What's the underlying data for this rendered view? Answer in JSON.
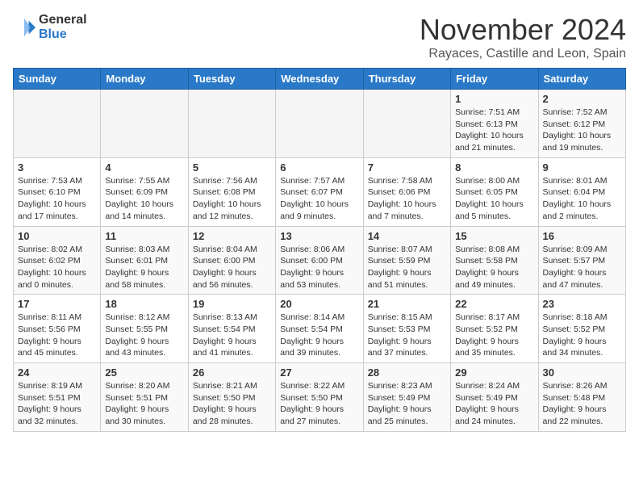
{
  "header": {
    "logo_general": "General",
    "logo_blue": "Blue",
    "month_title": "November 2024",
    "location": "Rayaces, Castille and Leon, Spain"
  },
  "days_of_week": [
    "Sunday",
    "Monday",
    "Tuesday",
    "Wednesday",
    "Thursday",
    "Friday",
    "Saturday"
  ],
  "weeks": [
    [
      {
        "day": "",
        "sunrise": "",
        "sunset": "",
        "daylight": ""
      },
      {
        "day": "",
        "sunrise": "",
        "sunset": "",
        "daylight": ""
      },
      {
        "day": "",
        "sunrise": "",
        "sunset": "",
        "daylight": ""
      },
      {
        "day": "",
        "sunrise": "",
        "sunset": "",
        "daylight": ""
      },
      {
        "day": "",
        "sunrise": "",
        "sunset": "",
        "daylight": ""
      },
      {
        "day": "1",
        "sunrise": "Sunrise: 7:51 AM",
        "sunset": "Sunset: 6:13 PM",
        "daylight": "Daylight: 10 hours and 21 minutes."
      },
      {
        "day": "2",
        "sunrise": "Sunrise: 7:52 AM",
        "sunset": "Sunset: 6:12 PM",
        "daylight": "Daylight: 10 hours and 19 minutes."
      }
    ],
    [
      {
        "day": "3",
        "sunrise": "Sunrise: 7:53 AM",
        "sunset": "Sunset: 6:10 PM",
        "daylight": "Daylight: 10 hours and 17 minutes."
      },
      {
        "day": "4",
        "sunrise": "Sunrise: 7:55 AM",
        "sunset": "Sunset: 6:09 PM",
        "daylight": "Daylight: 10 hours and 14 minutes."
      },
      {
        "day": "5",
        "sunrise": "Sunrise: 7:56 AM",
        "sunset": "Sunset: 6:08 PM",
        "daylight": "Daylight: 10 hours and 12 minutes."
      },
      {
        "day": "6",
        "sunrise": "Sunrise: 7:57 AM",
        "sunset": "Sunset: 6:07 PM",
        "daylight": "Daylight: 10 hours and 9 minutes."
      },
      {
        "day": "7",
        "sunrise": "Sunrise: 7:58 AM",
        "sunset": "Sunset: 6:06 PM",
        "daylight": "Daylight: 10 hours and 7 minutes."
      },
      {
        "day": "8",
        "sunrise": "Sunrise: 8:00 AM",
        "sunset": "Sunset: 6:05 PM",
        "daylight": "Daylight: 10 hours and 5 minutes."
      },
      {
        "day": "9",
        "sunrise": "Sunrise: 8:01 AM",
        "sunset": "Sunset: 6:04 PM",
        "daylight": "Daylight: 10 hours and 2 minutes."
      }
    ],
    [
      {
        "day": "10",
        "sunrise": "Sunrise: 8:02 AM",
        "sunset": "Sunset: 6:02 PM",
        "daylight": "Daylight: 10 hours and 0 minutes."
      },
      {
        "day": "11",
        "sunrise": "Sunrise: 8:03 AM",
        "sunset": "Sunset: 6:01 PM",
        "daylight": "Daylight: 9 hours and 58 minutes."
      },
      {
        "day": "12",
        "sunrise": "Sunrise: 8:04 AM",
        "sunset": "Sunset: 6:00 PM",
        "daylight": "Daylight: 9 hours and 56 minutes."
      },
      {
        "day": "13",
        "sunrise": "Sunrise: 8:06 AM",
        "sunset": "Sunset: 6:00 PM",
        "daylight": "Daylight: 9 hours and 53 minutes."
      },
      {
        "day": "14",
        "sunrise": "Sunrise: 8:07 AM",
        "sunset": "Sunset: 5:59 PM",
        "daylight": "Daylight: 9 hours and 51 minutes."
      },
      {
        "day": "15",
        "sunrise": "Sunrise: 8:08 AM",
        "sunset": "Sunset: 5:58 PM",
        "daylight": "Daylight: 9 hours and 49 minutes."
      },
      {
        "day": "16",
        "sunrise": "Sunrise: 8:09 AM",
        "sunset": "Sunset: 5:57 PM",
        "daylight": "Daylight: 9 hours and 47 minutes."
      }
    ],
    [
      {
        "day": "17",
        "sunrise": "Sunrise: 8:11 AM",
        "sunset": "Sunset: 5:56 PM",
        "daylight": "Daylight: 9 hours and 45 minutes."
      },
      {
        "day": "18",
        "sunrise": "Sunrise: 8:12 AM",
        "sunset": "Sunset: 5:55 PM",
        "daylight": "Daylight: 9 hours and 43 minutes."
      },
      {
        "day": "19",
        "sunrise": "Sunrise: 8:13 AM",
        "sunset": "Sunset: 5:54 PM",
        "daylight": "Daylight: 9 hours and 41 minutes."
      },
      {
        "day": "20",
        "sunrise": "Sunrise: 8:14 AM",
        "sunset": "Sunset: 5:54 PM",
        "daylight": "Daylight: 9 hours and 39 minutes."
      },
      {
        "day": "21",
        "sunrise": "Sunrise: 8:15 AM",
        "sunset": "Sunset: 5:53 PM",
        "daylight": "Daylight: 9 hours and 37 minutes."
      },
      {
        "day": "22",
        "sunrise": "Sunrise: 8:17 AM",
        "sunset": "Sunset: 5:52 PM",
        "daylight": "Daylight: 9 hours and 35 minutes."
      },
      {
        "day": "23",
        "sunrise": "Sunrise: 8:18 AM",
        "sunset": "Sunset: 5:52 PM",
        "daylight": "Daylight: 9 hours and 34 minutes."
      }
    ],
    [
      {
        "day": "24",
        "sunrise": "Sunrise: 8:19 AM",
        "sunset": "Sunset: 5:51 PM",
        "daylight": "Daylight: 9 hours and 32 minutes."
      },
      {
        "day": "25",
        "sunrise": "Sunrise: 8:20 AM",
        "sunset": "Sunset: 5:51 PM",
        "daylight": "Daylight: 9 hours and 30 minutes."
      },
      {
        "day": "26",
        "sunrise": "Sunrise: 8:21 AM",
        "sunset": "Sunset: 5:50 PM",
        "daylight": "Daylight: 9 hours and 28 minutes."
      },
      {
        "day": "27",
        "sunrise": "Sunrise: 8:22 AM",
        "sunset": "Sunset: 5:50 PM",
        "daylight": "Daylight: 9 hours and 27 minutes."
      },
      {
        "day": "28",
        "sunrise": "Sunrise: 8:23 AM",
        "sunset": "Sunset: 5:49 PM",
        "daylight": "Daylight: 9 hours and 25 minutes."
      },
      {
        "day": "29",
        "sunrise": "Sunrise: 8:24 AM",
        "sunset": "Sunset: 5:49 PM",
        "daylight": "Daylight: 9 hours and 24 minutes."
      },
      {
        "day": "30",
        "sunrise": "Sunrise: 8:26 AM",
        "sunset": "Sunset: 5:48 PM",
        "daylight": "Daylight: 9 hours and 22 minutes."
      }
    ]
  ]
}
